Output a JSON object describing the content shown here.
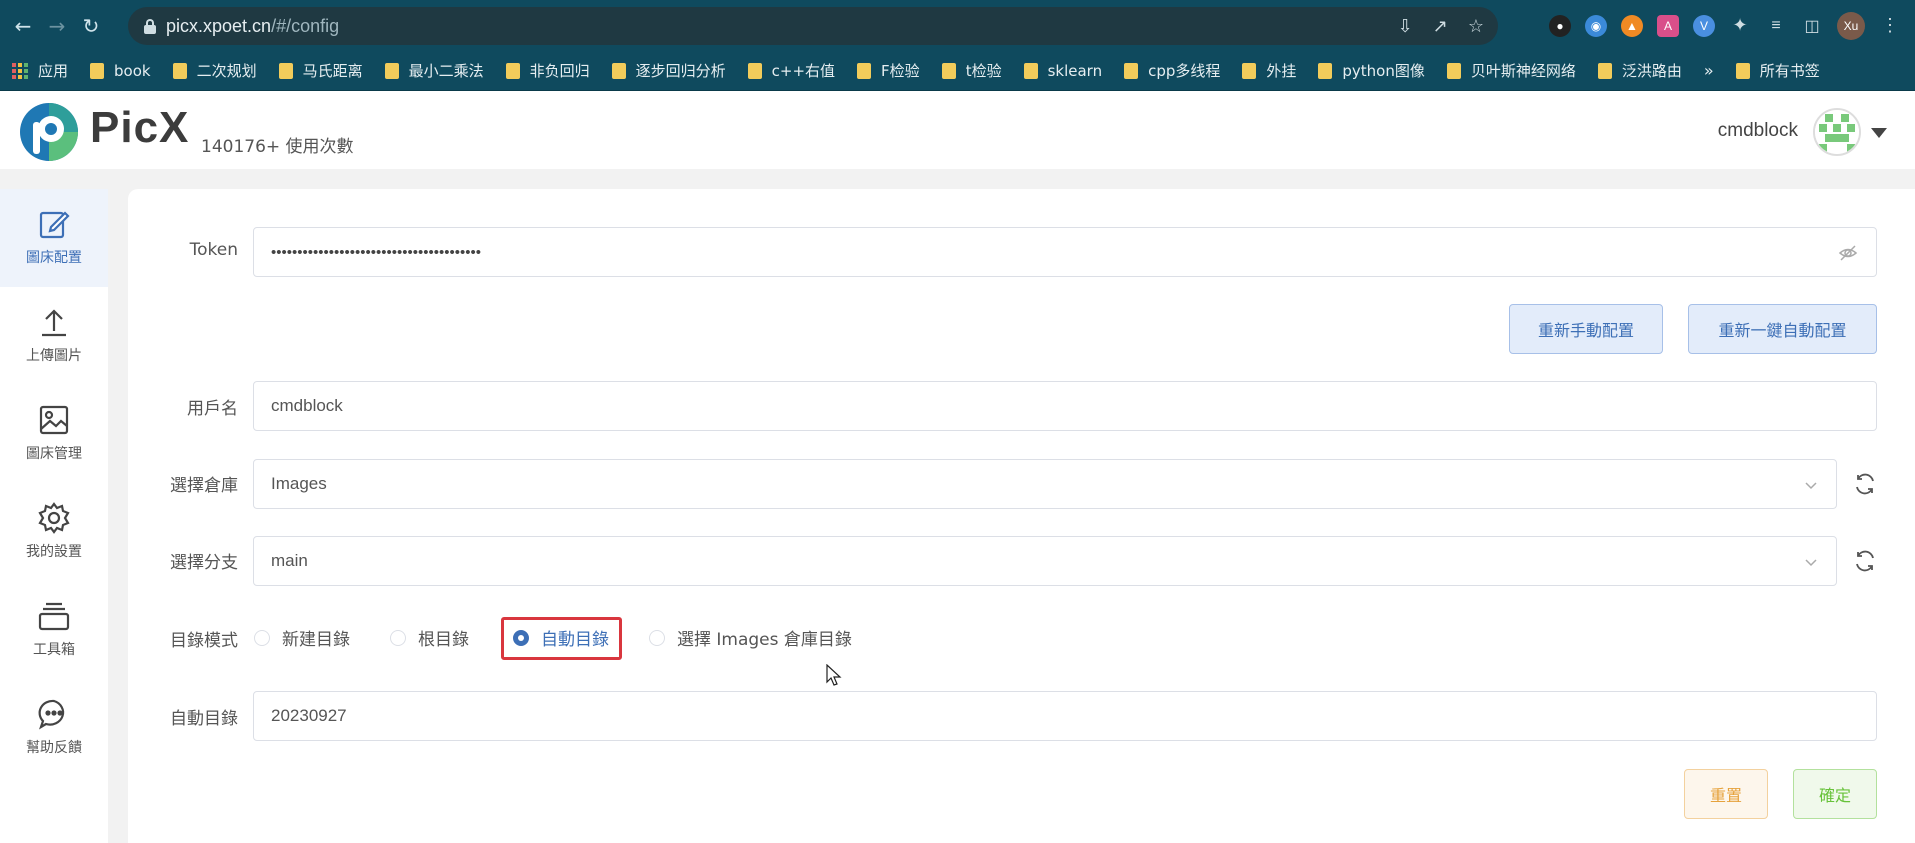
{
  "browser": {
    "url_host": "picx.xpoet.cn",
    "url_path": "/#/config",
    "profile_initials": "Xu"
  },
  "bookmarks": {
    "apps_label": "应用",
    "items": [
      "book",
      "二次规划",
      "马氏距离",
      "最小二乘法",
      "非负回归",
      "逐步回归分析",
      "c++右值",
      "F检验",
      "t检验",
      "sklearn",
      "cpp多线程",
      "外挂",
      "python图像",
      "贝叶斯神经网络",
      "泛洪路由"
    ],
    "more": "»",
    "all_bookmarks": "所有书签"
  },
  "header": {
    "brand": "PicX",
    "usage": "140176+ 使用次數",
    "username": "cmdblock"
  },
  "sidebar": {
    "items": [
      {
        "label": "圖床配置",
        "icon": "edit-icon"
      },
      {
        "label": "上傳圖片",
        "icon": "upload-icon"
      },
      {
        "label": "圖床管理",
        "icon": "image-icon"
      },
      {
        "label": "我的設置",
        "icon": "gear-icon"
      },
      {
        "label": "工具箱",
        "icon": "toolbox-icon"
      },
      {
        "label": "幫助反饋",
        "icon": "chat-icon"
      }
    ]
  },
  "form": {
    "token_label": "Token",
    "token_value": "••••••••••••••••••••••••••••••••••••••••",
    "reconfig_manual": "重新手動配置",
    "reconfig_auto": "重新一鍵自動配置",
    "username_label": "用戶名",
    "username_value": "cmdblock",
    "repo_label": "選擇倉庫",
    "repo_value": "Images",
    "branch_label": "選擇分支",
    "branch_value": "main",
    "dir_mode_label": "目錄模式",
    "dir_modes": [
      "新建目錄",
      "根目錄",
      "自動目錄",
      "選擇 Images 倉庫目錄"
    ],
    "dir_mode_selected": "自動目錄",
    "auto_dir_label": "自動目錄",
    "auto_dir_value": "20230927",
    "reset_label": "重置",
    "confirm_label": "確定"
  },
  "colors": {
    "browser_bar": "#0f4a5e",
    "accent": "#3d6fb6",
    "highlight": "#d9363e",
    "reset": "#e6a23c",
    "confirm": "#67c23a"
  }
}
